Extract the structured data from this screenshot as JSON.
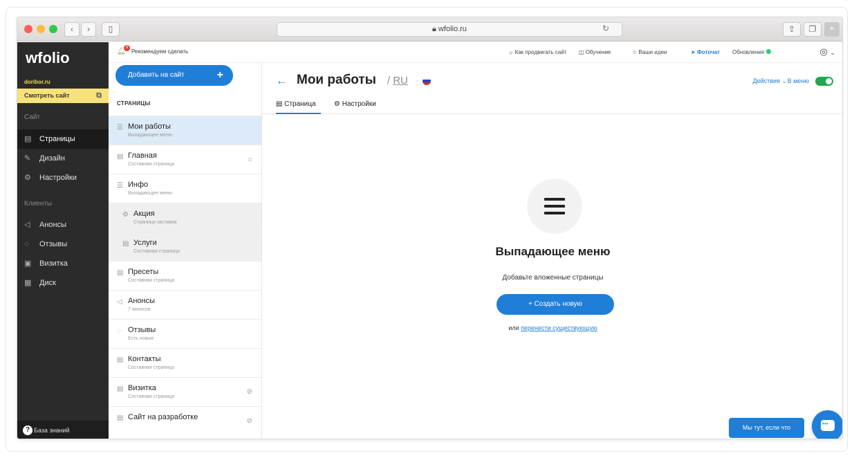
{
  "browser": {
    "url": "wfolio.ru",
    "nav_back": "‹",
    "nav_forward": "›"
  },
  "sidebar": {
    "logo": "wfolio",
    "domain": "doribor.ru",
    "view_site": "Смотреть сайт",
    "section_site": "Сайт",
    "section_clients": "Клиенты",
    "items_site": [
      {
        "label": "Страницы",
        "icon": "page-icon",
        "active": true
      },
      {
        "label": "Дизайн",
        "icon": "brush-icon",
        "active": false
      },
      {
        "label": "Настройки",
        "icon": "gear-icon",
        "active": false
      }
    ],
    "items_clients": [
      {
        "label": "Анонсы",
        "icon": "megaphone-icon"
      },
      {
        "label": "Отзывы",
        "icon": "comments-icon"
      },
      {
        "label": "Визитка",
        "icon": "card-icon"
      },
      {
        "label": "Диск",
        "icon": "disk-icon"
      }
    ],
    "knowledge_base": "База знаний"
  },
  "pages_panel": {
    "add_button": "Добавить на сайт",
    "title": "СТРАНИЦЫ",
    "pages": [
      {
        "name": "Мои работы",
        "desc": "Выпадающее меню",
        "icon": "menu-icon",
        "selected": true
      },
      {
        "name": "Главная",
        "desc": "Составная страница",
        "icon": "page-icon",
        "right_icon": "home-icon"
      },
      {
        "name": "Инфо",
        "desc": "Выпадающее меню",
        "icon": "menu-icon"
      },
      {
        "name": "Акция",
        "desc": "Страница-заставка",
        "icon": "gear-icon",
        "child": true
      },
      {
        "name": "Услуги",
        "desc": "Составная страница",
        "icon": "page-icon",
        "child": true
      },
      {
        "name": "Пресеты",
        "desc": "Составная страница",
        "icon": "page-icon"
      },
      {
        "name": "Анонсы",
        "desc": "7 анонсов",
        "icon": "megaphone-icon"
      },
      {
        "name": "Отзывы",
        "desc": "Есть новые",
        "icon": "comments-icon"
      },
      {
        "name": "Контакты",
        "desc": "Составная страница",
        "icon": "page-icon"
      },
      {
        "name": "Визитка",
        "desc": "Составная страница",
        "icon": "page-icon",
        "right_icon": "hidden-eye-icon"
      },
      {
        "name": "Сайт на разработке",
        "desc": "",
        "icon": "page-icon",
        "right_icon": "hidden-eye-icon"
      }
    ]
  },
  "topbar": {
    "recommend": "Рекомендуем сделать",
    "notification_count": "9",
    "links": [
      "Как продвигать сайт",
      "Обучение",
      "Ваши идеи"
    ],
    "photochat": "Фоточат",
    "updates": "Обновления"
  },
  "main": {
    "title": "Мои работы",
    "lang_sep": "/",
    "lang": "RU",
    "actions": "Действия",
    "in_menu": "В меню",
    "tabs": [
      "Страница",
      "Настройки"
    ],
    "empty_title": "Выпадающее меню",
    "empty_subtitle": "Добавьте вложенные страницы",
    "create_button": "+ Создать новую",
    "or_text": "или",
    "move_link": "перенести существующую"
  },
  "chat": {
    "label": "Мы тут, если что"
  },
  "colors": {
    "accent": "#1f7ed8",
    "sidebar_bg": "#2b2b2b",
    "highlight": "#f6e27a",
    "toggle_on": "#1fa84f"
  }
}
